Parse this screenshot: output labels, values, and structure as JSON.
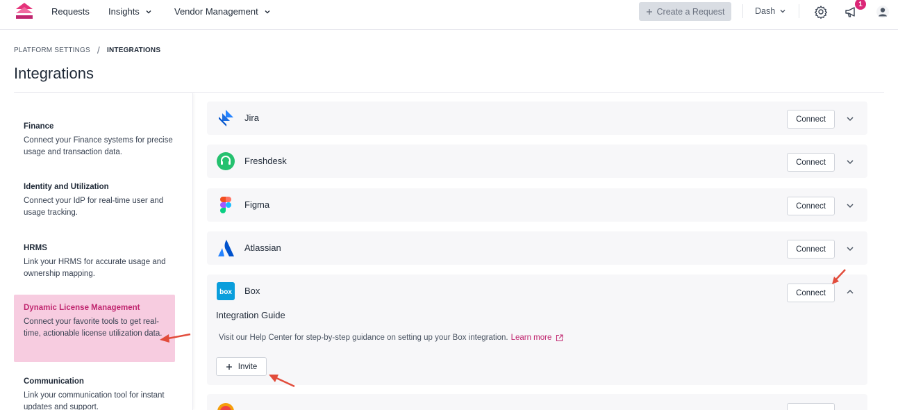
{
  "nav": {
    "items": [
      {
        "label": "Requests",
        "has_dropdown": false
      },
      {
        "label": "Insights",
        "has_dropdown": true
      },
      {
        "label": "Vendor Management",
        "has_dropdown": true
      }
    ],
    "create_request_label": "Create a Request",
    "workspace_label": "Dash",
    "notification_count": "1",
    "icons": [
      "logo-icon",
      "gear-icon",
      "megaphone-icon",
      "user-icon"
    ]
  },
  "breadcrumb": {
    "parent": "PLATFORM SETTINGS",
    "separator": "/",
    "current": "INTEGRATIONS"
  },
  "page": {
    "title": "Integrations"
  },
  "sidebar": {
    "items": [
      {
        "heading": "Finance",
        "description": "Connect your Finance systems for precise usage and transaction data.",
        "active": false
      },
      {
        "heading": "Identity and Utilization",
        "description": "Connect your IdP for real-time user and usage tracking.",
        "active": false
      },
      {
        "heading": "HRMS",
        "description": "Link your HRMS for accurate usage and ownership mapping.",
        "active": false
      },
      {
        "heading": "Dynamic License Management",
        "description": "Connect your favorite tools to get real-time, actionable license utilization data.",
        "active": true
      },
      {
        "heading": "Communication",
        "description": "Link your communication tool for instant updates and support.",
        "active": false
      }
    ]
  },
  "integrations": [
    {
      "name": "Jira",
      "button": "Connect",
      "expanded": false,
      "icon": "jira-icon"
    },
    {
      "name": "Freshdesk",
      "button": "Connect",
      "expanded": false,
      "icon": "freshdesk-icon"
    },
    {
      "name": "Figma",
      "button": "Connect",
      "expanded": false,
      "icon": "figma-icon"
    },
    {
      "name": "Atlassian",
      "button": "Connect",
      "expanded": false,
      "icon": "atlassian-icon"
    },
    {
      "name": "Box",
      "button": "Connect",
      "expanded": true,
      "icon": "box-icon",
      "guide_title": "Integration Guide",
      "guide_text": "Visit our Help Center for step-by-step guidance on setting up your Box integration.",
      "learn_more": "Learn more",
      "invite_label": "Invite"
    }
  ],
  "colors": {
    "accent": "#c0266f",
    "active_bg": "#f7cce0",
    "annotation_arrow": "#e24c3b",
    "card_bg": "#f7f7f9"
  }
}
